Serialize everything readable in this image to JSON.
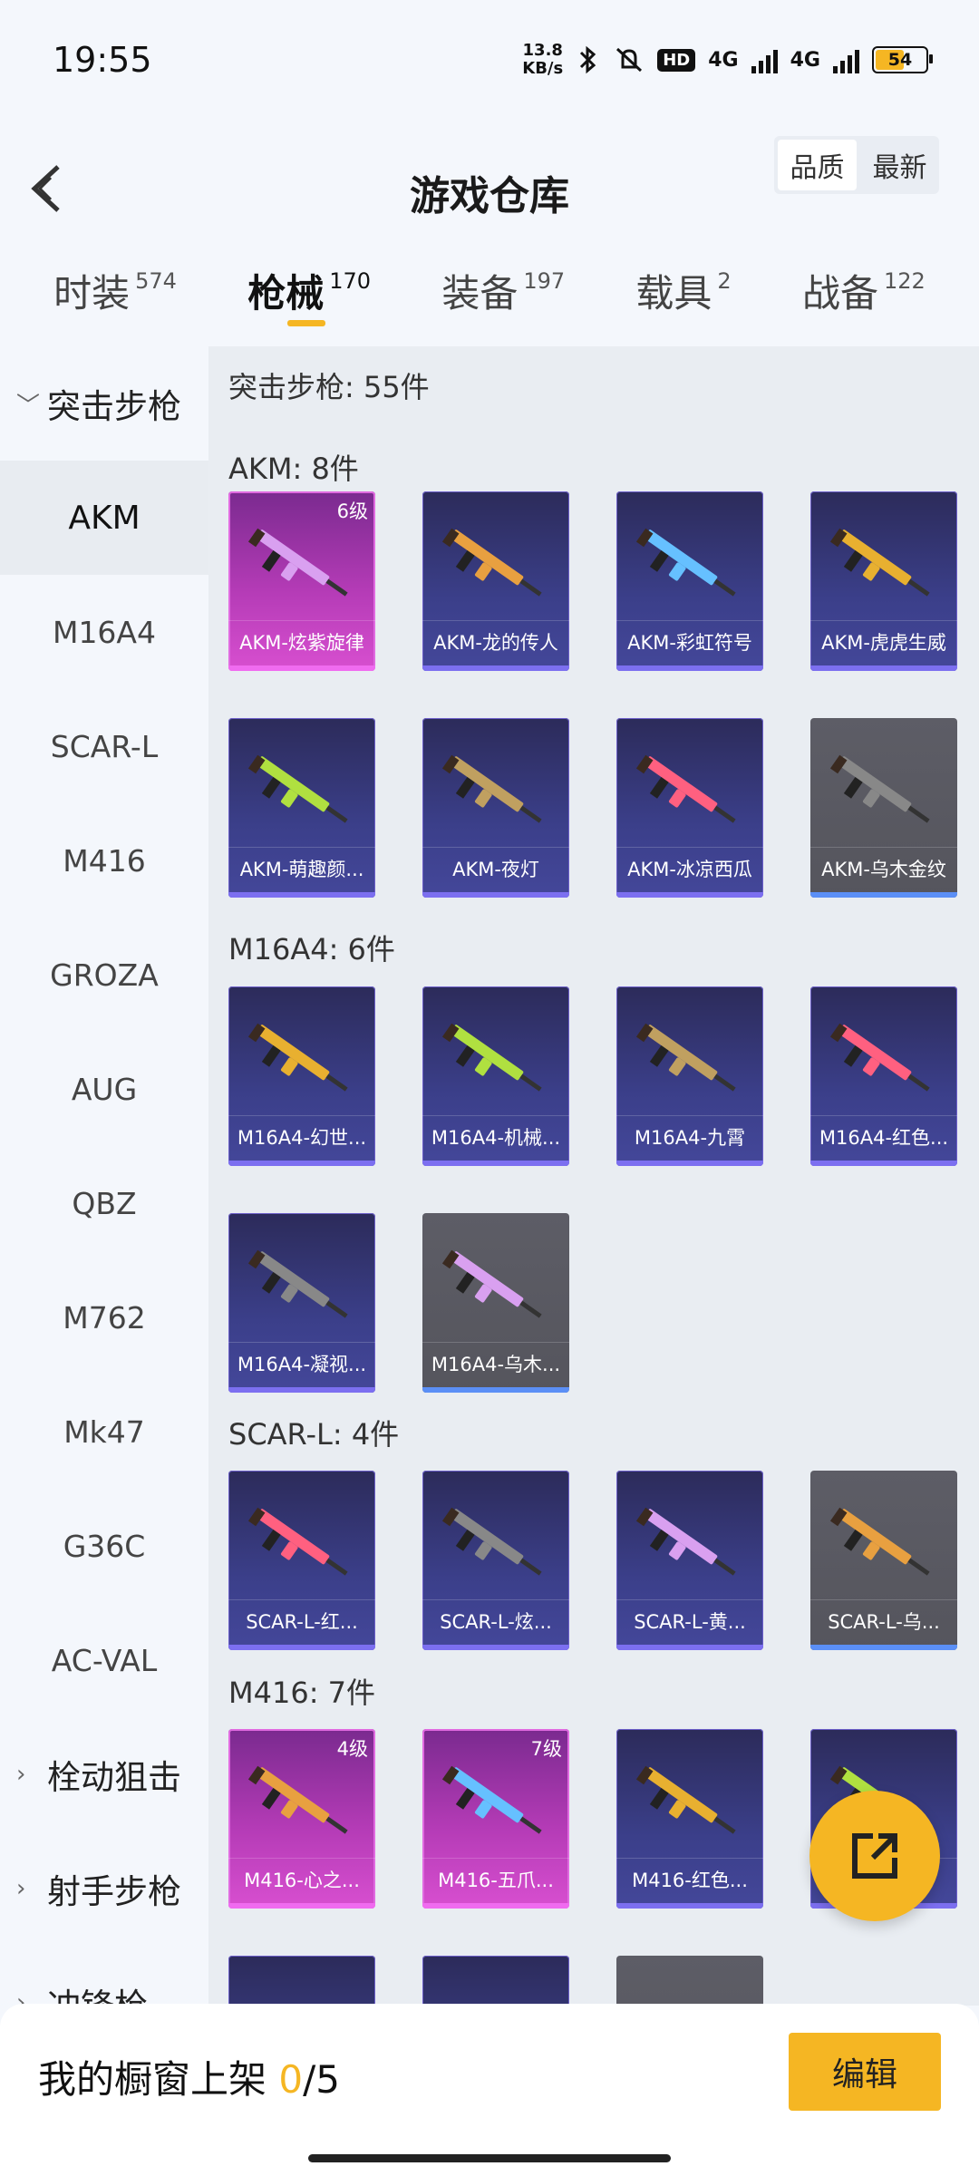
{
  "status": {
    "time": "19:55",
    "net_speed_value": "13.8",
    "net_speed_unit": "KB/s",
    "hd": "HD",
    "net1": "4G",
    "net2": "4G",
    "battery": "54"
  },
  "header": {
    "title": "游戏仓库",
    "sort_quality": "品质",
    "sort_latest": "最新"
  },
  "tabs": [
    {
      "label": "时装",
      "count": "574"
    },
    {
      "label": "枪械",
      "count": "170"
    },
    {
      "label": "装备",
      "count": "197"
    },
    {
      "label": "载具",
      "count": "2"
    },
    {
      "label": "战备",
      "count": "122"
    }
  ],
  "sidebar": {
    "category_open": "突击步枪",
    "items": [
      "AKM",
      "M16A4",
      "SCAR-L",
      "M416",
      "GROZA",
      "AUG",
      "QBZ",
      "M762",
      "Mk47",
      "G36C",
      "AC-VAL"
    ],
    "category_2": "栓动狙击",
    "category_3": "射手步枪",
    "category_4": "冲锋枪"
  },
  "content": {
    "total": "突击步枪: 55件",
    "sections": [
      {
        "title": "AKM: 8件",
        "items": [
          {
            "name": "AKM-炫紫旋律",
            "level": "6级"
          },
          {
            "name": "AKM-龙的传人"
          },
          {
            "name": "AKM-彩虹符号"
          },
          {
            "name": "AKM-虎虎生威"
          },
          {
            "name": "AKM-萌趣颜..."
          },
          {
            "name": "AKM-夜灯"
          },
          {
            "name": "AKM-冰凉西瓜"
          },
          {
            "name": "AKM-乌木金纹"
          }
        ]
      },
      {
        "title": "M16A4: 6件",
        "items": [
          {
            "name": "M16A4-幻世..."
          },
          {
            "name": "M16A4-机械..."
          },
          {
            "name": "M16A4-九霄"
          },
          {
            "name": "M16A4-红色..."
          },
          {
            "name": "M16A4-凝视..."
          },
          {
            "name": "M16A4-乌木..."
          }
        ]
      },
      {
        "title": "SCAR-L: 4件",
        "items": [
          {
            "name": "SCAR-L-红..."
          },
          {
            "name": "SCAR-L-炫..."
          },
          {
            "name": "SCAR-L-黄..."
          },
          {
            "name": "SCAR-L-乌..."
          }
        ]
      },
      {
        "title": "M416: 7件",
        "items": [
          {
            "name": "M416-心之...",
            "level": "4级"
          },
          {
            "name": "M416-五爪...",
            "level": "7级"
          },
          {
            "name": "M416-红色..."
          },
          {
            "name": ""
          }
        ]
      }
    ]
  },
  "bottom": {
    "label": "我的橱窗上架",
    "current": "0",
    "sep_total": "/5",
    "edit": "编辑"
  },
  "colors": {
    "accent": "#f5b623",
    "purple_tier": "#d84fd0",
    "blue_tier": "#3b3f8a",
    "gray_tier": "#55555d"
  }
}
